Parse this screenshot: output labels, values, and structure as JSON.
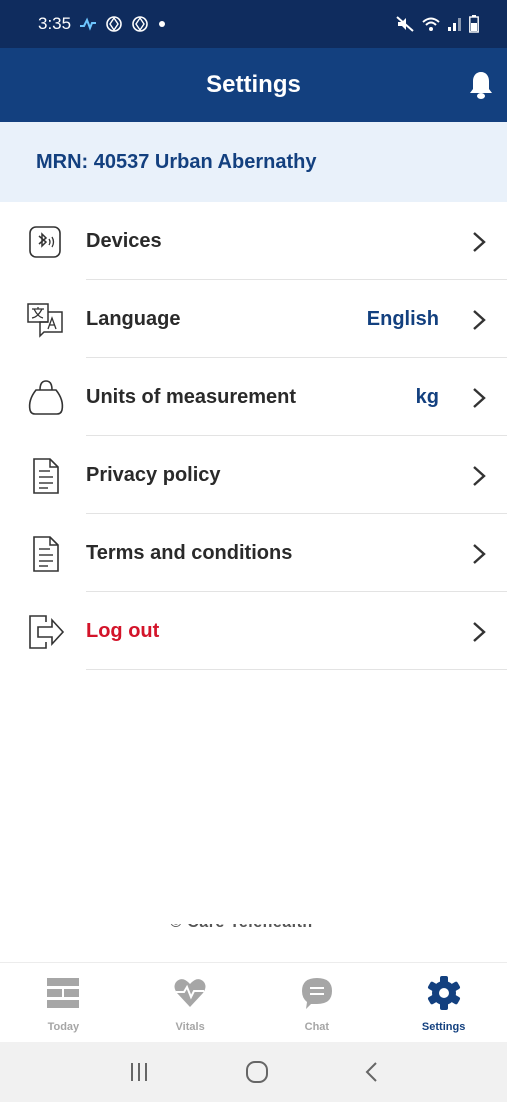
{
  "status_bar": {
    "time": "3:35",
    "left_icons": [
      "activity-icon",
      "vpn-icon",
      "vpn-icon",
      "dot-icon"
    ],
    "right_icons": [
      "mute-icon",
      "wifi-icon",
      "signal-icon",
      "battery-icon"
    ]
  },
  "header": {
    "title": "Settings",
    "notification_icon": "bell-icon"
  },
  "patient": {
    "mrn_label": "MRN: 40537 Urban Abernathy"
  },
  "settings": {
    "items": [
      {
        "label": "Devices",
        "value": "",
        "icon": "bluetooth-device-icon"
      },
      {
        "label": "Language",
        "value": "English",
        "icon": "translate-icon"
      },
      {
        "label": "Units of measurement",
        "value": "kg",
        "icon": "weight-icon"
      },
      {
        "label": "Privacy policy",
        "value": "",
        "icon": "document-icon"
      },
      {
        "label": "Terms and conditions",
        "value": "",
        "icon": "document-icon"
      },
      {
        "label": "Log out",
        "value": "",
        "icon": "logout-icon"
      }
    ]
  },
  "footer_partial_text": "© Care Telehealth",
  "tabs": [
    {
      "label": "Today",
      "icon": "today-grid-icon",
      "active": false
    },
    {
      "label": "Vitals",
      "icon": "heart-pulse-icon",
      "active": false
    },
    {
      "label": "Chat",
      "icon": "chat-bubble-icon",
      "active": false
    },
    {
      "label": "Settings",
      "icon": "gear-icon",
      "active": true
    }
  ],
  "colors": {
    "header": "#13407f",
    "status_bar": "#0f2c5e",
    "mrn_background": "#e9f1fa",
    "accent": "#13407f",
    "logout": "#d3142a",
    "inactive_tab": "#a6a6a6"
  }
}
